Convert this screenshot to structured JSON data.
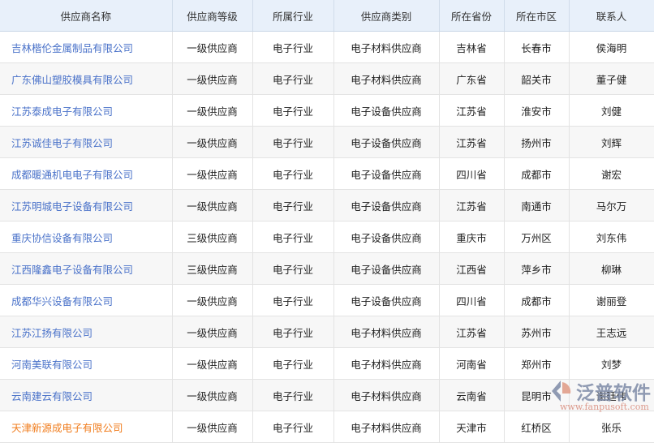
{
  "columns": [
    "供应商名称",
    "供应商等级",
    "所属行业",
    "供应商类别",
    "所在省份",
    "所在市区",
    "联系人"
  ],
  "rows": [
    [
      "吉林楷伦金属制品有限公司",
      "一级供应商",
      "电子行业",
      "电子材料供应商",
      "吉林省",
      "长春市",
      "侯海明"
    ],
    [
      "广东佛山塑胶模具有限公司",
      "一级供应商",
      "电子行业",
      "电子材料供应商",
      "广东省",
      "韶关市",
      "董子健"
    ],
    [
      "江苏泰成电子有限公司",
      "一级供应商",
      "电子行业",
      "电子设备供应商",
      "江苏省",
      "淮安市",
      "刘健"
    ],
    [
      "江苏诚佳电子有限公司",
      "一级供应商",
      "电子行业",
      "电子设备供应商",
      "江苏省",
      "扬州市",
      "刘辉"
    ],
    [
      "成都暖通机电电子有限公司",
      "一级供应商",
      "电子行业",
      "电子设备供应商",
      "四川省",
      "成都市",
      "谢宏"
    ],
    [
      "江苏明城电子设备有限公司",
      "一级供应商",
      "电子行业",
      "电子设备供应商",
      "江苏省",
      "南通市",
      "马尔万"
    ],
    [
      "重庆协信设备有限公司",
      "三级供应商",
      "电子行业",
      "电子设备供应商",
      "重庆市",
      "万州区",
      "刘东伟"
    ],
    [
      "江西隆鑫电子设备有限公司",
      "三级供应商",
      "电子行业",
      "电子设备供应商",
      "江西省",
      "萍乡市",
      "柳琳"
    ],
    [
      "成都华兴设备有限公司",
      "一级供应商",
      "电子行业",
      "电子设备供应商",
      "四川省",
      "成都市",
      "谢丽登"
    ],
    [
      "江苏江扬有限公司",
      "一级供应商",
      "电子行业",
      "电子材料供应商",
      "江苏省",
      "苏州市",
      "王志远"
    ],
    [
      "河南美联有限公司",
      "一级供应商",
      "电子行业",
      "电子材料供应商",
      "河南省",
      "郑州市",
      "刘梦"
    ],
    [
      "云南建云有限公司",
      "一级供应商",
      "电子行业",
      "电子材料供应商",
      "云南省",
      "昆明市",
      "谢廷伟"
    ],
    [
      "天津新源成电子有限公司",
      "一级供应商",
      "电子行业",
      "电子材料供应商",
      "天津市",
      "红桥区",
      "张乐"
    ]
  ],
  "highlight_row": 12,
  "watermark": {
    "text": "泛普软件",
    "url": "www.fanpusoft.com"
  }
}
